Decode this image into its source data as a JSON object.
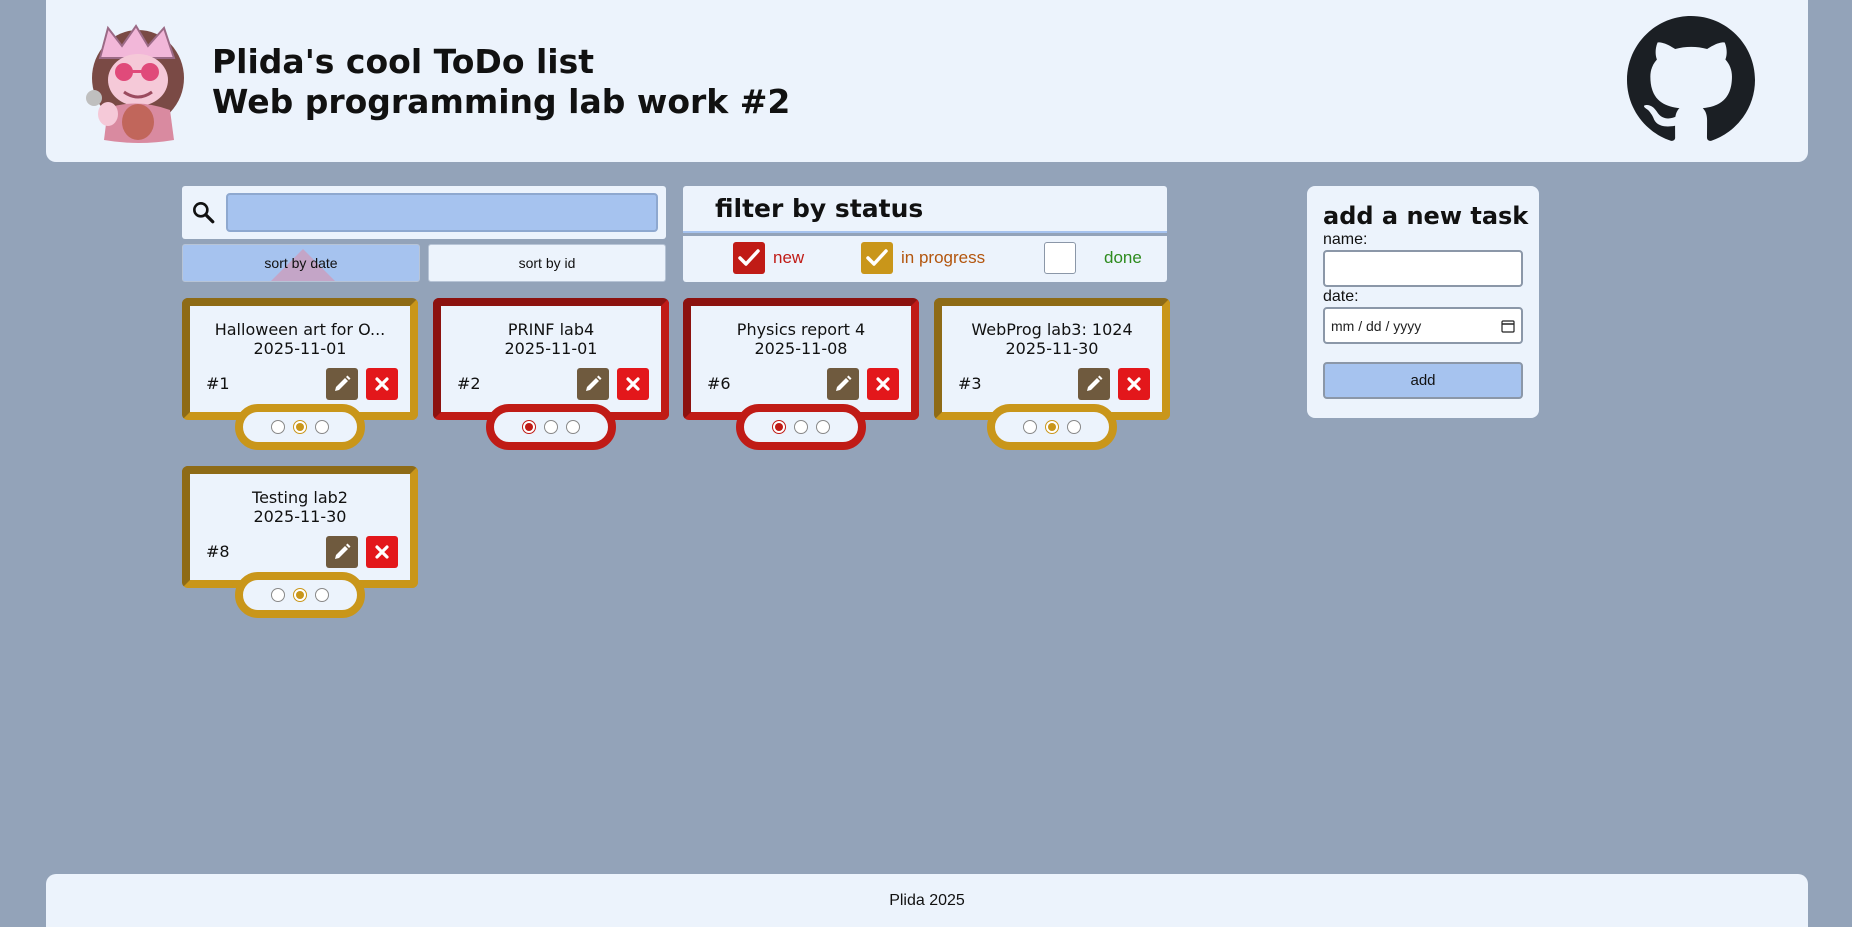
{
  "header": {
    "title_line1": "Plida's cool ToDo list",
    "title_line2": "Web programming lab work #2"
  },
  "search": {
    "placeholder": "",
    "value": ""
  },
  "sort": {
    "by_date_label": "sort by date",
    "by_id_label": "sort by id",
    "active": "date"
  },
  "filter": {
    "title": "filter by status",
    "options": [
      {
        "label": "new",
        "checked": true,
        "color": "#c01b16"
      },
      {
        "label": "in progress",
        "checked": true,
        "color": "#c9961a"
      },
      {
        "label": "done",
        "checked": false,
        "color": "#2e8b1e"
      }
    ]
  },
  "add_task": {
    "title": "add a new task",
    "name_label": "name:",
    "date_label": "date:",
    "date_placeholder": "mm / dd / yyyy",
    "add_button": "add"
  },
  "tasks": [
    {
      "name": "Halloween art for O...",
      "date": "2025-11-01",
      "id": "#1",
      "status": "in progress"
    },
    {
      "name": "PRINF lab4",
      "date": "2025-11-01",
      "id": "#2",
      "status": "new"
    },
    {
      "name": "Physics report 4",
      "date": "2025-11-08",
      "id": "#6",
      "status": "new"
    },
    {
      "name": "WebProg lab3: 1024",
      "date": "2025-11-30",
      "id": "#3",
      "status": "in progress"
    },
    {
      "name": "Testing lab2",
      "date": "2025-11-30",
      "id": "#8",
      "status": "in progress"
    }
  ],
  "footer": {
    "text": "Plida 2025"
  },
  "colors": {
    "background": "#93a3b9",
    "panel": "#ecf3fc",
    "accent": "#a6c3ef",
    "status_new": "#c01b16",
    "status_in_progress": "#c9961a",
    "delete": "#e3171b",
    "edit": "#6f5a3e"
  }
}
